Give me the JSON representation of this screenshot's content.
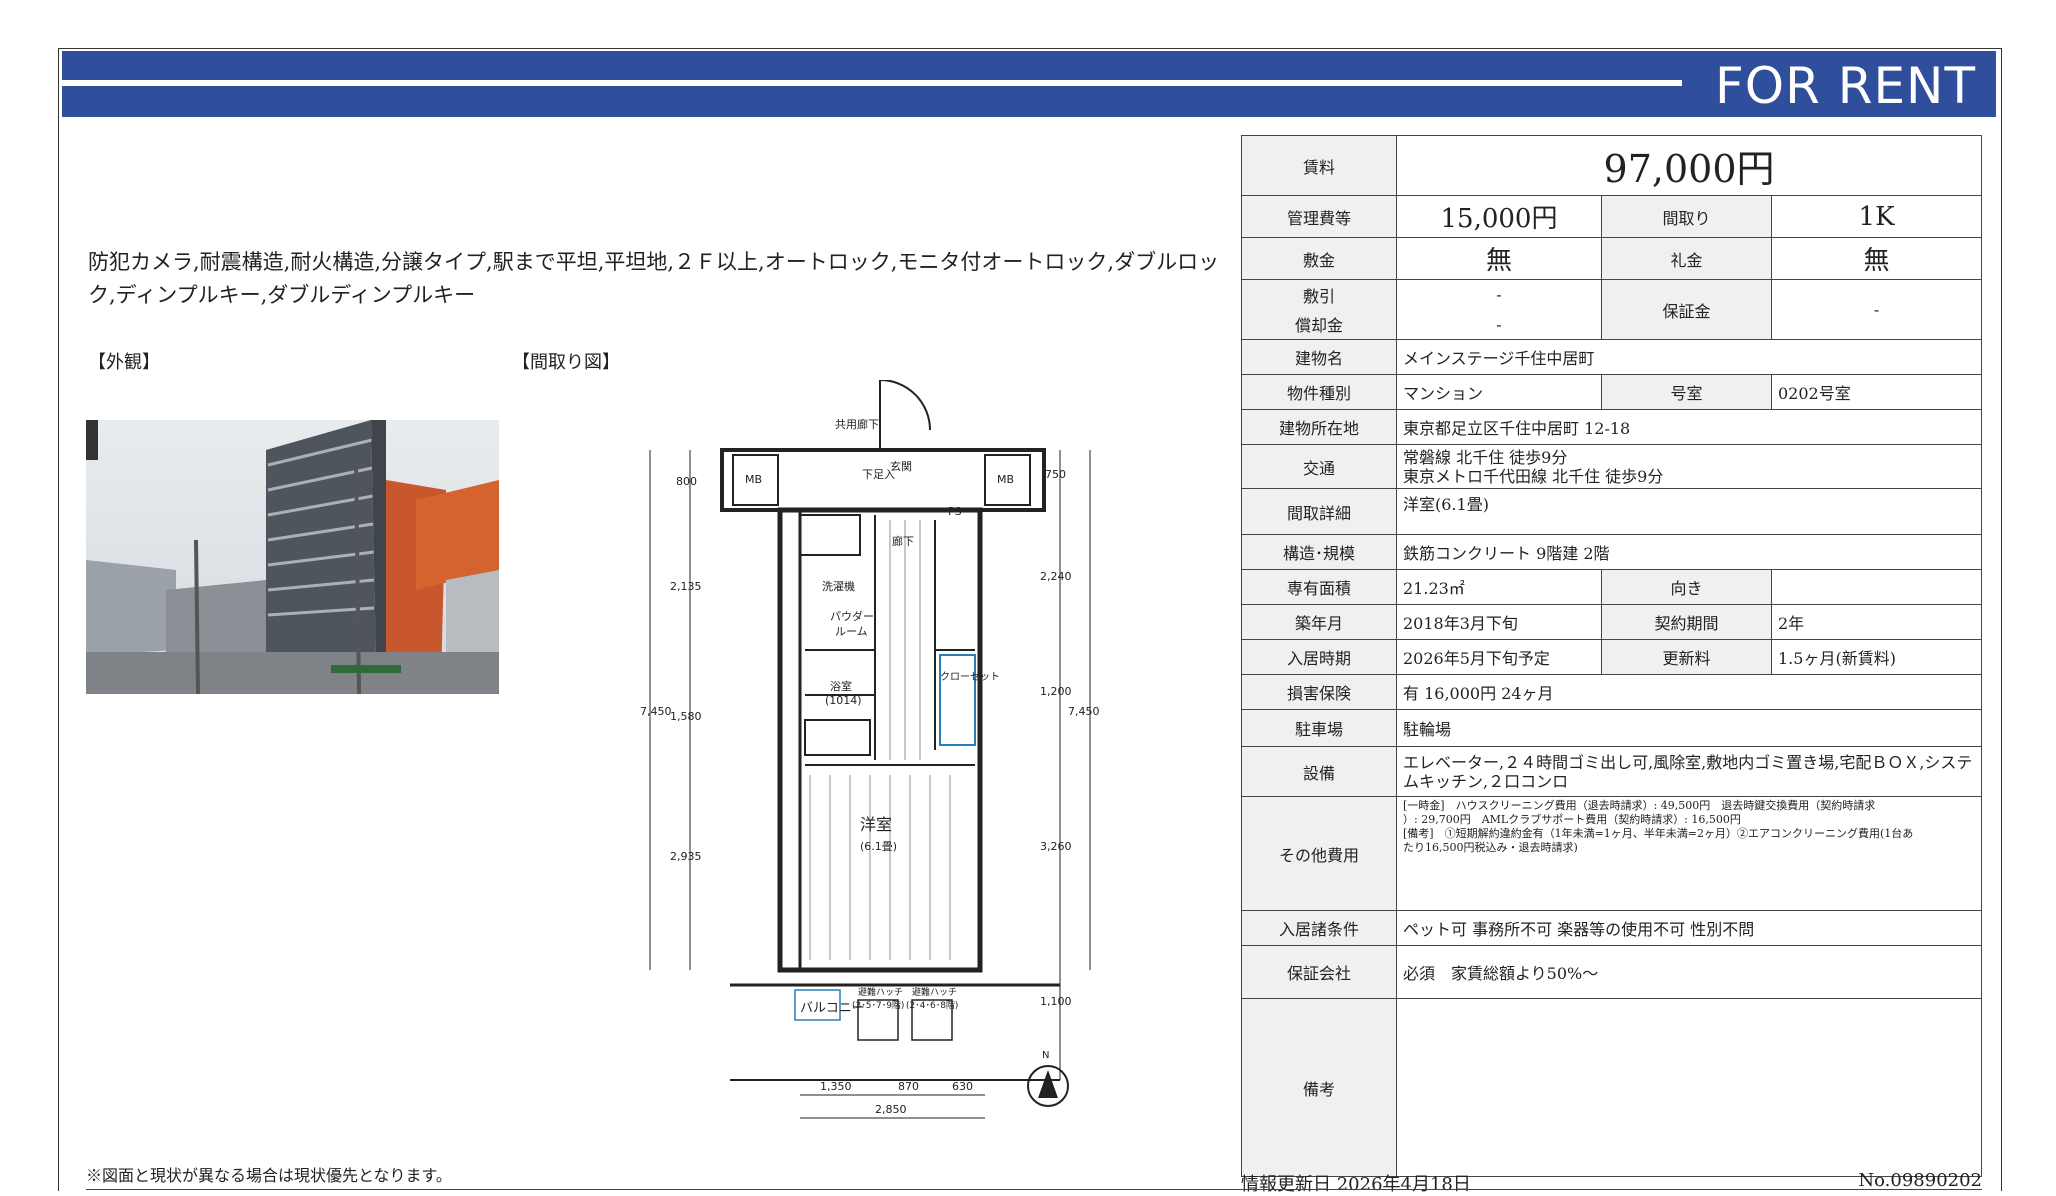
{
  "banner": {
    "title": "FOR RENT"
  },
  "features_text": "防犯カメラ,耐震構造,耐火構造,分譲タイプ,駅まで平坦,平坦地,２Ｆ以上,オートロック,モニタ付オートロック,ダブルロック,ディンプルキー,ダブルディンプルキー",
  "labels": {
    "exterior": "【外観】",
    "floorplan": "【間取り図】"
  },
  "disclaimer": "※図面と現状が異なる場合は現状優先となります。",
  "spec": {
    "rent_label": "賃料",
    "rent": "97,000円",
    "mgmt_label": "管理費等",
    "mgmt": "15,000円",
    "layout_label": "間取り",
    "layout": "1K",
    "deposit_label": "敷金",
    "deposit": "無",
    "keymoney_label": "礼金",
    "keymoney": "無",
    "shikibiki_label": "敷引",
    "shikibiki": "-",
    "shokyaku_label": "償却金",
    "shokyaku": "-",
    "guarantee_label": "保証金",
    "guarantee": "-",
    "building_label": "建物名",
    "building": "メインステージ千住中居町",
    "type_label": "物件種別",
    "type": "マンション",
    "room_label": "号室",
    "room": "0202号室",
    "address_label": "建物所在地",
    "address": "東京都足立区千住中居町 12-18",
    "access_label": "交通",
    "access1": "常磐線 北千住 徒歩9分",
    "access2": "東京メトロ千代田線 北千住 徒歩9分",
    "detail_label": "間取詳細",
    "detail": "洋室(6.1畳)",
    "structure_label": "構造･規模",
    "structure": "鉄筋コンクリート 9階建 2階",
    "area_label": "専有面積",
    "area": "21.23㎡",
    "direction_label": "向き",
    "direction": "",
    "built_label": "築年月",
    "built": "2018年3月下旬",
    "term_label": "契約期間",
    "term": "2年",
    "movein_label": "入居時期",
    "movein": "2026年5月下旬予定",
    "renewal_label": "更新料",
    "renewal": "1.5ヶ月(新賃料)",
    "insurance_label": "損害保険",
    "insurance": "有  16,000円  24ヶ月",
    "parking_label": "駐車場",
    "parking": "駐輪場",
    "facilities_label": "設備",
    "facilities": "エレベーター,２４時間ゴミ出し可,風除室,敷地内ゴミ置き場,宅配ＢＯＸ,システムキッチン,２口コンロ",
    "other_label": "その他費用",
    "other1": "[一時金]　ハウスクリーニング費用（退去時請求）: 49,500円　退去時鍵交換費用（契約時請求",
    "other2": "）: 29,700円　AMLクラブサポート費用（契約時請求）: 16,500円",
    "other3": "[備考]　①短期解約違約金有（1年未満=1ヶ月、半年未満=2ヶ月）②エアコンクリーニング費用(1台あ",
    "other4": "たり16,500円税込み・退去時請求)",
    "conditions_label": "入居諸条件",
    "conditions": "ペット可 事務所不可 楽器等の使用不可 性別不問",
    "company_label": "保証会社",
    "company": "必須　家賃総額より50%～",
    "remarks_label": "備考",
    "remarks": ""
  },
  "footer": {
    "updated": "情報更新日 2026年4月18日",
    "docno": "No.09890202"
  },
  "floorplan": {
    "corridor": "共用廊下",
    "entrance": "玄関",
    "mb": "MB",
    "shoebox": "下足入",
    "ps": "PS",
    "hall": "廊下",
    "laundry": "洗濯機",
    "powder1": "パウダー",
    "powder2": "ルーム",
    "bath": "浴室",
    "bath_size": "(1014)",
    "closet": "クローゼット",
    "room": "洋室",
    "room_size": "(6.1畳)",
    "balcony": "バルコニー",
    "hatch1": "避難ハッチ",
    "hatch1b": "(3･5･7･9階)",
    "hatch2": "避難ハッチ",
    "hatch2b": "(2･4･6･8階)",
    "dims_left": [
      "800",
      "2,135",
      "1,580",
      "2,935"
    ],
    "total_left": "7,450",
    "dims_right": [
      "750",
      "2,240",
      "1,200",
      "3,260",
      "1,100"
    ],
    "total_right": "7,450",
    "dims_bottom": [
      "1,350",
      "870",
      "630"
    ],
    "total_bottom": "2,850",
    "north": "N"
  }
}
